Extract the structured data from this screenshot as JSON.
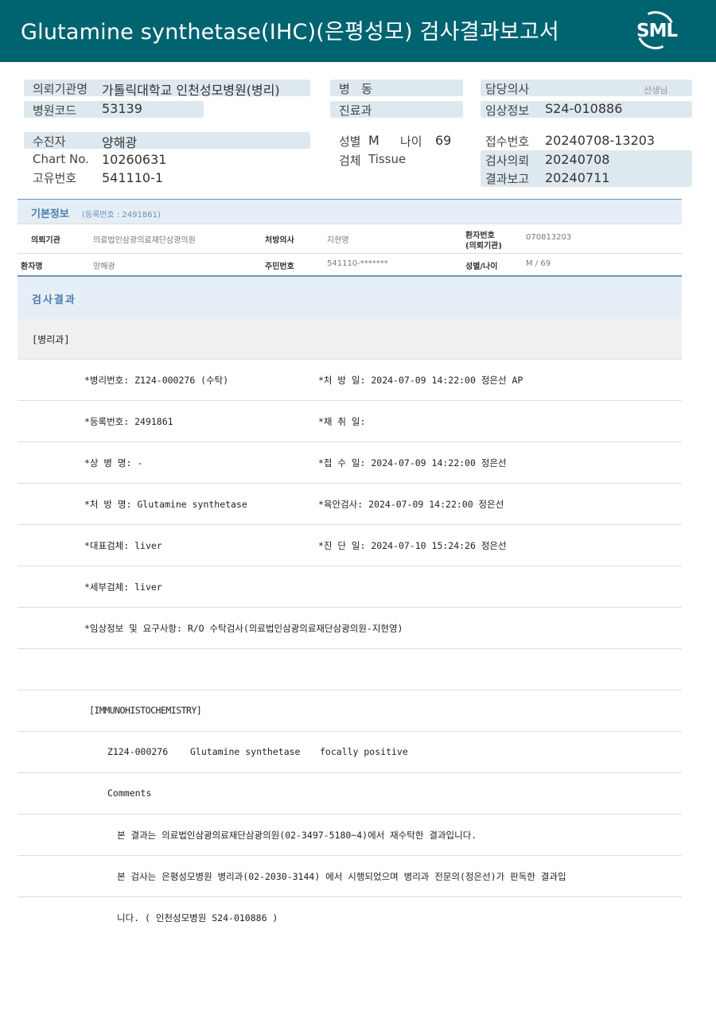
{
  "header": {
    "title": "Glutamine  synthetase(IHC)(은평성모) 검사결과보고서",
    "logo_text": "SML"
  },
  "top": {
    "institution_label": "의뢰기관명",
    "institution_value": "가톨릭대학교 인천성모병원(병리)",
    "hospital_code_label": "병원코드",
    "hospital_code_value": "53139",
    "ward_label": "병   동",
    "department_label": "진료과",
    "doctor_label": "담당의사",
    "doctor_suffix": "선생님",
    "clinical_label": "임상정보",
    "clinical_value": "S24-010886",
    "patient_label": "수진자",
    "patient_value": "양해광",
    "chart_label": "Chart No.",
    "chart_value": "10260631",
    "unique_label": "고유번호",
    "unique_value": "541110-1",
    "sex_label": "성별",
    "sex_value": "M",
    "age_label": "나이",
    "age_value": "69",
    "specimen_label": "검체",
    "specimen_value": "Tissue",
    "receipt_label": "접수번호",
    "receipt_value": "20240708-13203",
    "request_label": "검사의뢰",
    "request_value": "20240708",
    "report_label": "결과보고",
    "report_value": "20240711"
  },
  "basic": {
    "title": "기본정보",
    "reg": "(등록번호 : 2491861)",
    "inst_label": "의뢰기관",
    "inst_value": "의료법인삼광의료재단삼광의원",
    "presc_label": "처방의사",
    "presc_value": "지현영",
    "pno_label_1": "환자번호",
    "pno_label_2": "(의뢰기관)",
    "pno_value": "070813203",
    "name_label": "환자명",
    "name_value": "양해광",
    "rrn_label": "주민번호",
    "rrn_value": "541110-*******",
    "sexage_label": "성별/나이",
    "sexage_value": "M / 69"
  },
  "result": {
    "title": "검사결과",
    "dept": "[병리과]",
    "rows": [
      {
        "left": "*병리번호: Z124-000276 (수탁)",
        "right": "*처 방 일: 2024-07-09 14:22:00  정은선 AP"
      },
      {
        "left": "*등록번호: 2491861",
        "right": "*채 취 일:"
      },
      {
        "left": "*상 병 명: -",
        "right": "*접 수 일: 2024-07-09 14:22:00  정은선"
      },
      {
        "left": "*처 방 명: Glutamine synthetase",
        "right": "*육안검사: 2024-07-09 14:22:00  정은선"
      },
      {
        "left": "*대표검체: liver",
        "right": "*진 단 일: 2024-07-10 15:24:26  정은선"
      },
      {
        "left": "*세부검체: liver",
        "right": ""
      },
      {
        "left": "*임상정보 및 요구사항: R/O 수탁검사(의료법인삼광의료재단삼광의원-지현영)",
        "right": ""
      }
    ],
    "ihc_header": "[IMMUNOHISTOCHEMISTRY]",
    "ihc_id": "Z124-000276",
    "ihc_name": "Glutamine synthetase",
    "ihc_result": "focally positive",
    "comments_label": "Comments",
    "comment_1": "본 결과는 의료법인삼광의료재단삼광의원(02-3497-5180~4)에서 재수탁한 결과입니다.",
    "comment_2": "본 검사는 은평성모병원 병리과(02-2030-3144) 에서 시행되었으며 병리과 전문의(정은선)가 판독한 결과입",
    "comment_3": "니다. ( 인천성모병원 S24-010886 )"
  }
}
